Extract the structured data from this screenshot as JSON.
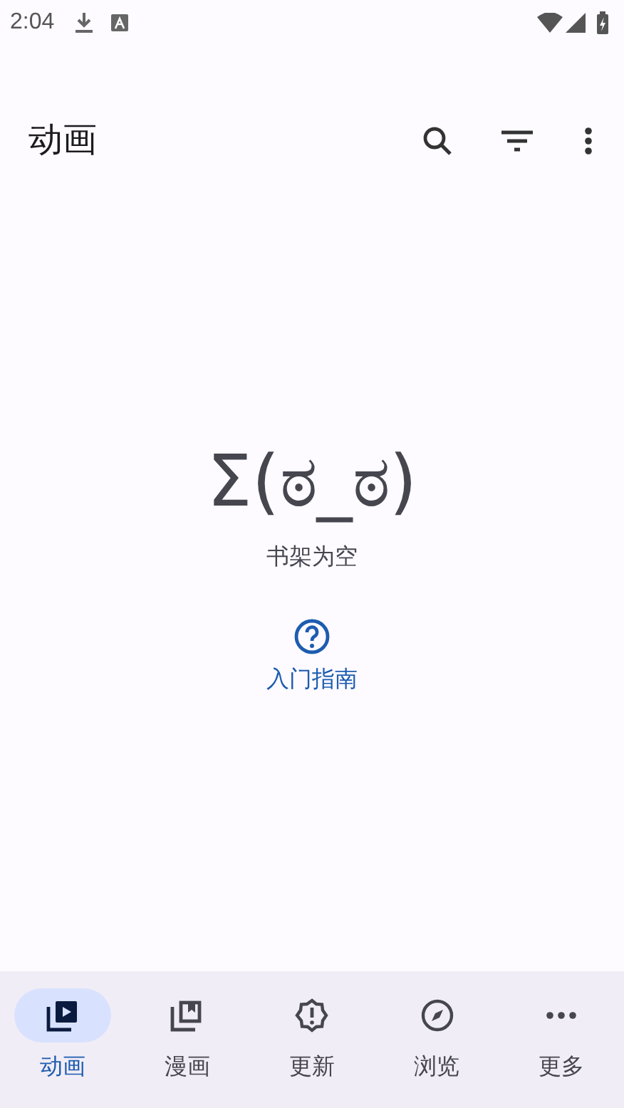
{
  "status_bar": {
    "time": "2:04"
  },
  "app_bar": {
    "title": "动画"
  },
  "empty_state": {
    "face": "Σ(ಠ_ಠ)",
    "message": "书架为空",
    "help_link": "入门指南"
  },
  "nav": [
    {
      "kind": "anime",
      "label": "动画",
      "selected": true
    },
    {
      "kind": "manga",
      "label": "漫画",
      "selected": false
    },
    {
      "kind": "updates",
      "label": "更新",
      "selected": false
    },
    {
      "kind": "browse",
      "label": "浏览",
      "selected": false
    },
    {
      "kind": "more",
      "label": "更多",
      "selected": false
    }
  ]
}
